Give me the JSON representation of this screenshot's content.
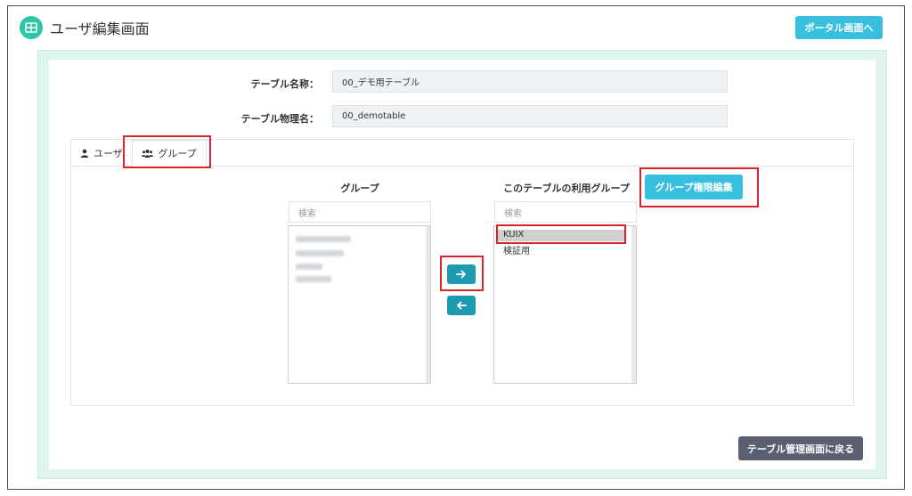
{
  "header": {
    "title": "ユーザ編集画面",
    "portal_button": "ポータル画面へ"
  },
  "form": {
    "table_name_label": "テーブル名称：",
    "table_name_value": "00_デモ用テーブル",
    "physical_name_label": "テーブル物理名：",
    "physical_name_value": "00_demotable"
  },
  "tabs": [
    {
      "label": "ユーザ",
      "icon": "user-icon",
      "active": false
    },
    {
      "label": "グループ",
      "icon": "users-icon",
      "active": true
    }
  ],
  "left_list": {
    "title": "グループ",
    "search_placeholder": "検索"
  },
  "right_list": {
    "title": "このテーブルの利用グループ",
    "search_placeholder": "検索",
    "items": [
      "KUIX",
      "検証用"
    ],
    "selected_item": "KUIX"
  },
  "buttons": {
    "move_right_icon": "arrow-right-icon",
    "move_left_icon": "arrow-left-icon",
    "edit_permissions": "グループ権限編集",
    "back_to_table_management": "テーブル管理画面に戻る"
  },
  "colors": {
    "accent_teal": "#2ec4a7",
    "button_cyan": "#38bfe0",
    "arrow_button": "#1e9bb0",
    "dark_button": "#5a6070",
    "highlight_red": "#d9252a"
  }
}
